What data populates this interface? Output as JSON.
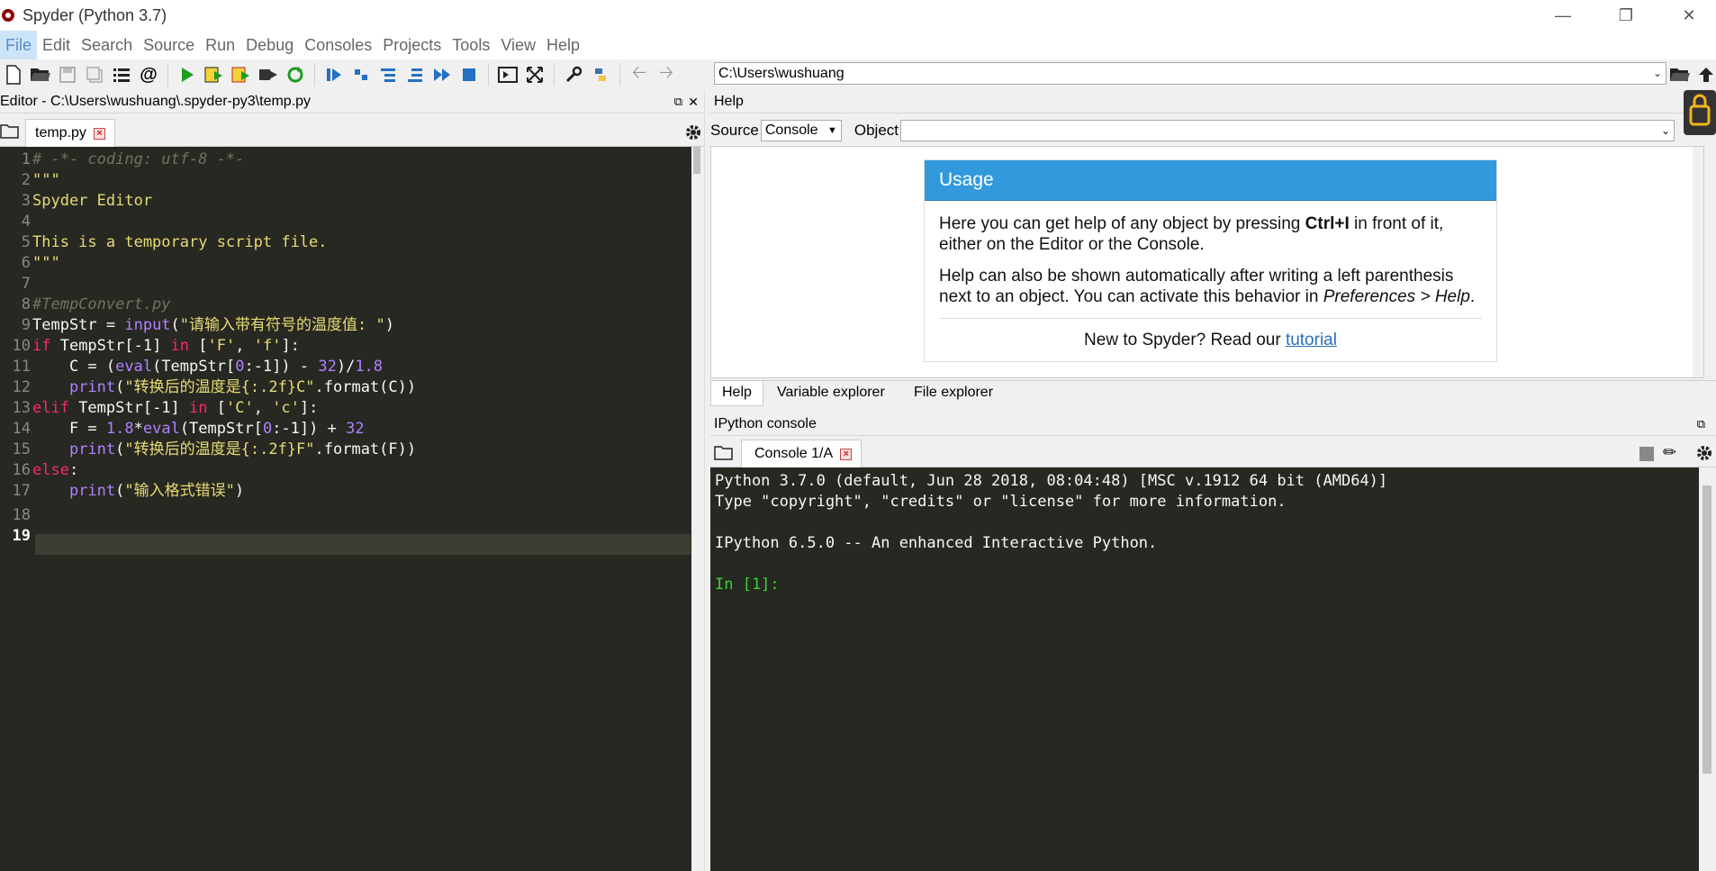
{
  "window": {
    "title": "Spyder (Python 3.7)"
  },
  "menu": [
    "File",
    "Edit",
    "Search",
    "Source",
    "Run",
    "Debug",
    "Consoles",
    "Projects",
    "Tools",
    "View",
    "Help"
  ],
  "toolbar": {
    "path": "C:\\Users\\wushuang"
  },
  "editor": {
    "pane_title": "Editor - C:\\Users\\wushuang\\.spyder-py3\\temp.py",
    "tab": "temp.py",
    "current_line": 19
  },
  "help": {
    "pane_title": "Help",
    "source_label": "Source",
    "source_value": "Console",
    "object_label": "Object",
    "usage_title": "Usage",
    "p1_pre": "Here you can get help of any object by pressing ",
    "p1_key": "Ctrl+I",
    "p1_post": " in front of it, either on the Editor or the Console.",
    "p2_pre": "Help can also be shown automatically after writing a left parenthesis next to an object. You can activate this behavior in ",
    "p2_em": "Preferences > Help",
    "p2_post": ".",
    "tut_pre": "New to Spyder? Read our ",
    "tut_link": "tutorial",
    "tabs": [
      "Help",
      "Variable explorer",
      "File explorer"
    ]
  },
  "console": {
    "pane_title": "IPython console",
    "tab": "Console 1/A",
    "lines": [
      "Python 3.7.0 (default, Jun 28 2018, 08:04:48) [MSC v.1912 64 bit (AMD64)]",
      "Type \"copyright\", \"credits\" or \"license\" for more information.",
      "",
      "IPython 6.5.0 -- An enhanced Interactive Python.",
      ""
    ],
    "prompt": "In [1]:"
  },
  "icons": [
    "new-file-icon",
    "open-file-icon",
    "save-icon",
    "save-all-icon",
    "outline-icon",
    "at-icon",
    "run-icon",
    "run-cell-icon",
    "run-cell-advance-icon",
    "run-selection-icon",
    "rerun-icon",
    "debug-icon",
    "step-icon",
    "step-into-icon",
    "step-return-icon",
    "continue-icon",
    "stop-icon",
    "maximize-pane-icon",
    "fullscreen-icon",
    "preferences-icon",
    "python-path-icon",
    "back-icon",
    "forward-icon",
    "browse-icon",
    "parent-dir-icon"
  ]
}
